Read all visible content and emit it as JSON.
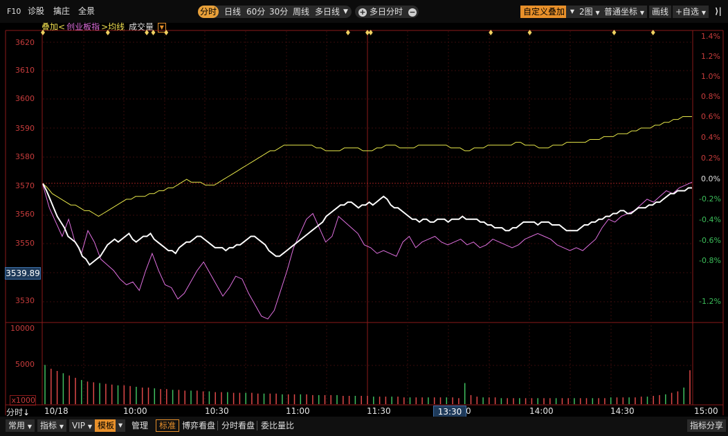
{
  "toolbar": {
    "f10": "F10",
    "diagnose": "诊股",
    "catch": "擒庄",
    "panorama": "全景",
    "period_buttons": [
      "分时",
      "日线",
      "60分",
      "30分",
      "周线",
      "多日线"
    ],
    "active_period": "分时",
    "multi_day": "多日分时",
    "plus": "+",
    "minus": "−",
    "custom_overlay": "自定义叠加",
    "graphs": "2图",
    "coordinate": "普通坐标",
    "draw": "画线",
    "watchlist": "+自选",
    "collapse": "⟩|"
  },
  "legend": {
    "overlay": "叠加<",
    "index": "创业板指",
    "avg": ">均线",
    "volume": "成交量"
  },
  "axis": {
    "price_ticks": [
      "3620",
      "3610",
      "3600",
      "3590",
      "3580",
      "3570",
      "3560",
      "3550",
      "3540",
      "3530"
    ],
    "pct_ticks": [
      "1.4%",
      "1.2%",
      "1.0%",
      "0.8%",
      "0.6%",
      "0.4%",
      "0.2%",
      "0.0%",
      "-0.2%",
      "-0.4%",
      "-0.6%",
      "-0.8%",
      "-1.2%"
    ],
    "vol_ticks": [
      "10000",
      "5000",
      "x1000"
    ],
    "time_ticks": [
      "10/18",
      "10:00",
      "10:30",
      "11:00",
      "11:30",
      "14:00",
      "14:30",
      "15:00"
    ],
    "time_tick_fragment": "0"
  },
  "cursor": {
    "price": "3539.89",
    "time": "13:30"
  },
  "bottom": {
    "minute_label": "分时",
    "arrow": "↓",
    "tabs": [
      "常用",
      "指标",
      "VIP",
      "模板",
      "管理",
      "标准",
      "博弈看盘",
      "分时看盘",
      "委比量比"
    ],
    "active_tab": "模板",
    "highlight_tab": "标准",
    "right_button": "指标分享"
  },
  "colors": {
    "accent": "#e8902a",
    "axis_red": "#c83c3c",
    "index_line": "#ffffff",
    "avg_line": "#e8e84a",
    "overlay_line": "#e070e0",
    "vol_up": "#e04848",
    "vol_down": "#40c060",
    "event_dot": "#f0d060"
  },
  "chart_data": {
    "type": "line",
    "ylim": [
      3522,
      3624
    ],
    "base": 3570.6,
    "main_series": [
      3570.5,
      3568,
      3565,
      3562,
      3559,
      3557,
      3555,
      3552,
      3551,
      3550,
      3548,
      3545,
      3544,
      3542,
      3543,
      3544,
      3545,
      3547,
      3549,
      3550,
      3551,
      3550,
      3551,
      3552,
      3553,
      3551,
      3550,
      3551,
      3552,
      3552,
      3553,
      3551,
      3550,
      3549,
      3548,
      3547,
      3547,
      3546,
      3548,
      3549,
      3550,
      3550,
      3551,
      3552,
      3552,
      3551,
      3550,
      3549,
      3548,
      3548,
      3548,
      3547,
      3548,
      3548,
      3549,
      3549,
      3550,
      3551,
      3552,
      3552,
      3551,
      3550,
      3549,
      3547,
      3546,
      3545,
      3545,
      3546,
      3547,
      3548,
      3549,
      3550,
      3551,
      3552,
      3553,
      3554,
      3555,
      3556,
      3557,
      3559,
      3560,
      3561,
      3562,
      3563,
      3563,
      3564,
      3564,
      3563,
      3562,
      3563,
      3563,
      3564,
      3563,
      3564,
      3565,
      3566,
      3565,
      3563,
      3562,
      3562,
      3561,
      3560,
      3559,
      3558,
      3558,
      3557,
      3558,
      3558,
      3557,
      3557,
      3558,
      3558,
      3558,
      3557,
      3558,
      3558,
      3558,
      3559,
      3558,
      3558,
      3558,
      3558,
      3557,
      3557,
      3556,
      3556,
      3555,
      3555,
      3555,
      3554,
      3554,
      3555,
      3555,
      3556,
      3557,
      3557,
      3557,
      3557,
      3556,
      3557,
      3557,
      3557,
      3556,
      3556,
      3556,
      3555,
      3554,
      3554,
      3554,
      3554,
      3555,
      3556,
      3556,
      3557,
      3557,
      3558,
      3558,
      3559,
      3559,
      3560,
      3560,
      3561,
      3561,
      3560,
      3560,
      3561,
      3562,
      3562,
      3562,
      3563,
      3563,
      3564,
      3564,
      3565,
      3566,
      3567,
      3567,
      3568,
      3568,
      3568,
      3569,
      3569
    ],
    "avg_series": [
      3570.5,
      3569,
      3567,
      3566,
      3565,
      3564,
      3563,
      3563,
      3562,
      3561,
      3561,
      3560,
      3559,
      3560,
      3561,
      3562,
      3563,
      3564,
      3565,
      3565,
      3566,
      3566,
      3566,
      3567,
      3567,
      3568,
      3568,
      3569,
      3569,
      3570,
      3571,
      3572,
      3571,
      3571,
      3571,
      3570,
      3570,
      3570,
      3571,
      3572,
      3573,
      3574,
      3575,
      3576,
      3577,
      3578,
      3579,
      3580,
      3581,
      3582,
      3582,
      3583,
      3584,
      3584,
      3584,
      3584,
      3584,
      3584,
      3584,
      3583,
      3583,
      3582,
      3582,
      3582,
      3582,
      3583,
      3583,
      3583,
      3583,
      3582,
      3582,
      3582,
      3583,
      3583,
      3584,
      3584,
      3584,
      3583,
      3583,
      3583,
      3583,
      3584,
      3584,
      3584,
      3584,
      3584,
      3584,
      3584,
      3583,
      3583,
      3583,
      3582,
      3582,
      3583,
      3583,
      3583,
      3584,
      3584,
      3584,
      3584,
      3584,
      3584,
      3585,
      3585,
      3584,
      3584,
      3584,
      3583,
      3583,
      3583,
      3584,
      3584,
      3584,
      3585,
      3585,
      3585,
      3585,
      3585,
      3586,
      3586,
      3586,
      3587,
      3587,
      3587,
      3588,
      3588,
      3588,
      3589,
      3589,
      3590,
      3590,
      3590,
      3591,
      3591,
      3592,
      3592,
      3593,
      3593,
      3594,
      3594,
      3594
    ],
    "overlay_series": [
      3570,
      3562,
      3557,
      3552,
      3558,
      3550,
      3546,
      3554,
      3550,
      3544,
      3542,
      3540,
      3537,
      3535,
      3536,
      3533,
      3540,
      3546,
      3540,
      3535,
      3534,
      3530,
      3532,
      3536,
      3540,
      3543,
      3539,
      3535,
      3531,
      3534,
      3538,
      3537,
      3532,
      3528,
      3524,
      3523,
      3526,
      3533,
      3540,
      3548,
      3553,
      3558,
      3560,
      3555,
      3550,
      3552,
      3559,
      3557,
      3555,
      3553,
      3549,
      3548,
      3546,
      3547,
      3546,
      3545,
      3550,
      3552,
      3548,
      3550,
      3551,
      3552,
      3550,
      3549,
      3550,
      3551,
      3549,
      3550,
      3548,
      3549,
      3551,
      3550,
      3549,
      3548,
      3549,
      3551,
      3552,
      3553,
      3552,
      3551,
      3549,
      3548,
      3547,
      3548,
      3547,
      3549,
      3551,
      3555,
      3558,
      3557,
      3559,
      3560,
      3561,
      3563,
      3565,
      3564,
      3566,
      3568,
      3567,
      3569,
      3570,
      3571
    ],
    "volume": [
      5200,
      4700,
      4400,
      4100,
      3800,
      3500,
      3200,
      3000,
      2900,
      2800,
      2700,
      2600,
      2500,
      2500,
      2400,
      2300,
      2200,
      2200,
      2100,
      2000,
      2000,
      1900,
      1900,
      1800,
      1800,
      1800,
      1700,
      1700,
      1600,
      1600,
      1600,
      1500,
      1500,
      1500,
      1500,
      1400,
      1400,
      1400,
      1400,
      1300,
      1300,
      1300,
      1300,
      1300,
      1200,
      1200,
      1200,
      1200,
      1200,
      1100,
      1100,
      1100,
      1100,
      1100,
      1000,
      1000,
      1000,
      1000,
      1000,
      900,
      900,
      900,
      900,
      900,
      900,
      900,
      900,
      900,
      800,
      2800,
      1200,
      1000,
      900,
      900,
      900,
      800,
      800,
      800,
      800,
      800,
      800,
      800,
      800,
      800,
      800,
      800,
      800,
      800,
      800,
      800,
      800,
      800,
      800,
      900,
      900,
      900,
      900,
      900,
      1000,
      1000,
      1100,
      1200,
      1300,
      1500,
      1700,
      2200,
      4500
    ],
    "events_fraction": [
      0.0,
      0.1,
      0.16,
      0.17,
      0.19,
      0.47,
      0.5,
      0.505,
      0.69,
      0.75,
      0.88,
      0.94
    ],
    "pct_range": [
      -1.36,
      1.5
    ]
  }
}
